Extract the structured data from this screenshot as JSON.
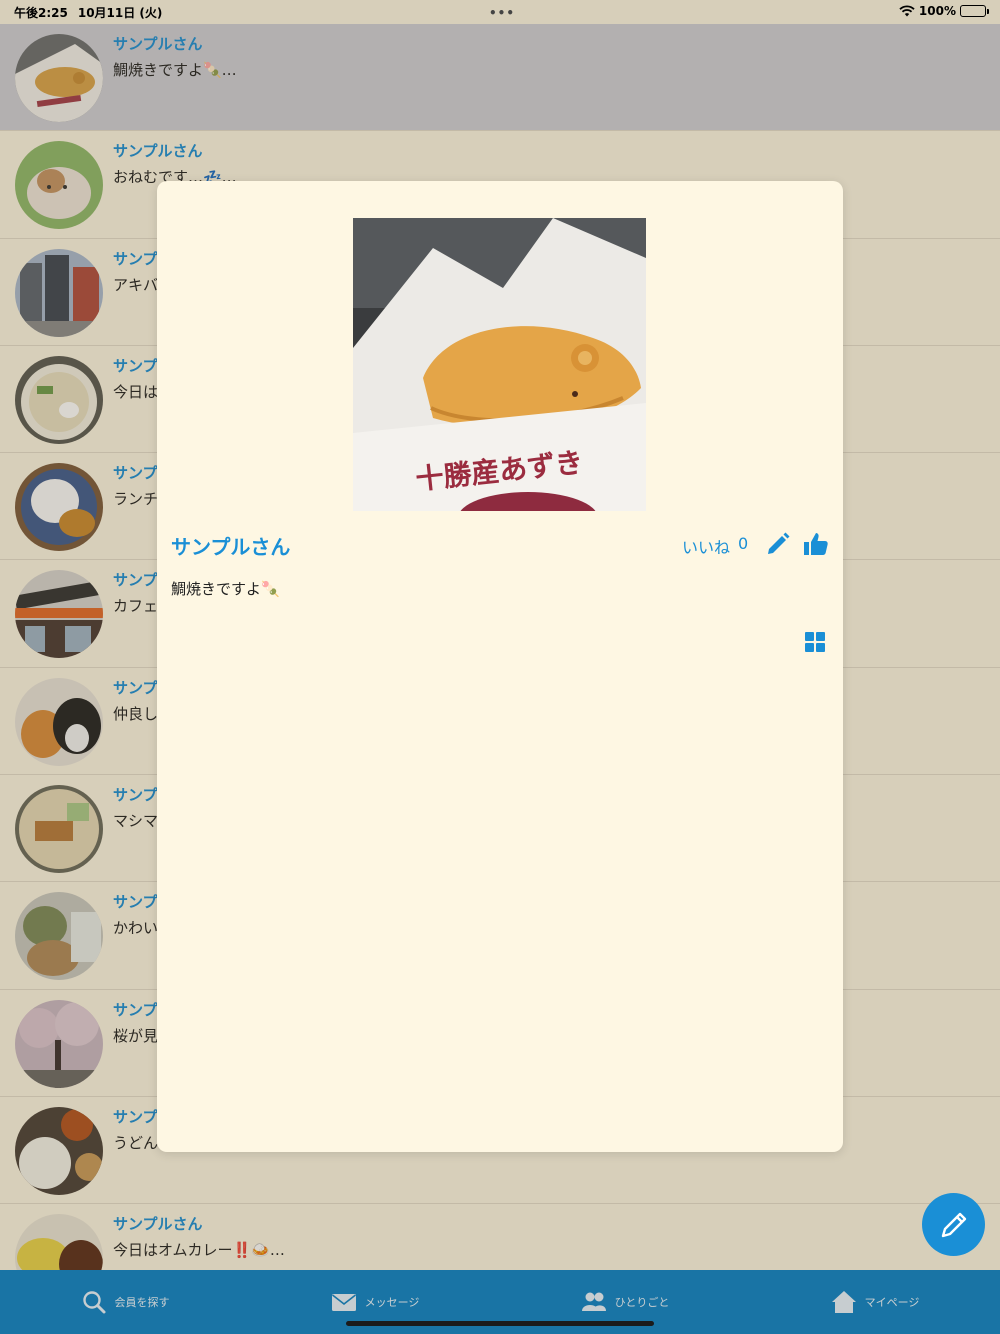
{
  "status": {
    "time": "午後2:25",
    "date": "10月11日 (火)",
    "battery": "100%"
  },
  "feed": [
    {
      "name": "サンプルさん",
      "text": "鯛焼きですよ🍡…",
      "selected": true
    },
    {
      "name": "サンプルさん",
      "text": "おねむです…💤…"
    },
    {
      "name": "サンプル",
      "text": "アキバ"
    },
    {
      "name": "サンプル",
      "text": "今日は"
    },
    {
      "name": "サンプル",
      "text": "ランチ"
    },
    {
      "name": "サンプル",
      "text": "カフェ"
    },
    {
      "name": "サンプル",
      "text": "仲良し"
    },
    {
      "name": "サンプル",
      "text": "マシマ"
    },
    {
      "name": "サンプル",
      "text": "かわい"
    },
    {
      "name": "サンプル",
      "text": "桜が見"
    },
    {
      "name": "サンプル",
      "text": "うどん"
    },
    {
      "name": "サンプルさん",
      "text": "今日はオムカレー‼️🍛…"
    }
  ],
  "modal": {
    "name": "サンプルさん",
    "likes_label": "いいね",
    "likes_count": "0",
    "text": "鯛焼きですよ🍡"
  },
  "tabs": [
    {
      "label": "会員を探す",
      "icon": "search-icon"
    },
    {
      "label": "メッセージ",
      "icon": "mail-icon"
    },
    {
      "label": "ひとりごと",
      "icon": "users-icon",
      "active": true
    },
    {
      "label": "マイページ",
      "icon": "home-icon"
    }
  ],
  "colors": {
    "accent": "#1a8fd6",
    "background": "#fdf6e3",
    "tabbar": "#0a82c8",
    "selected_row": "#cfcfd6"
  }
}
